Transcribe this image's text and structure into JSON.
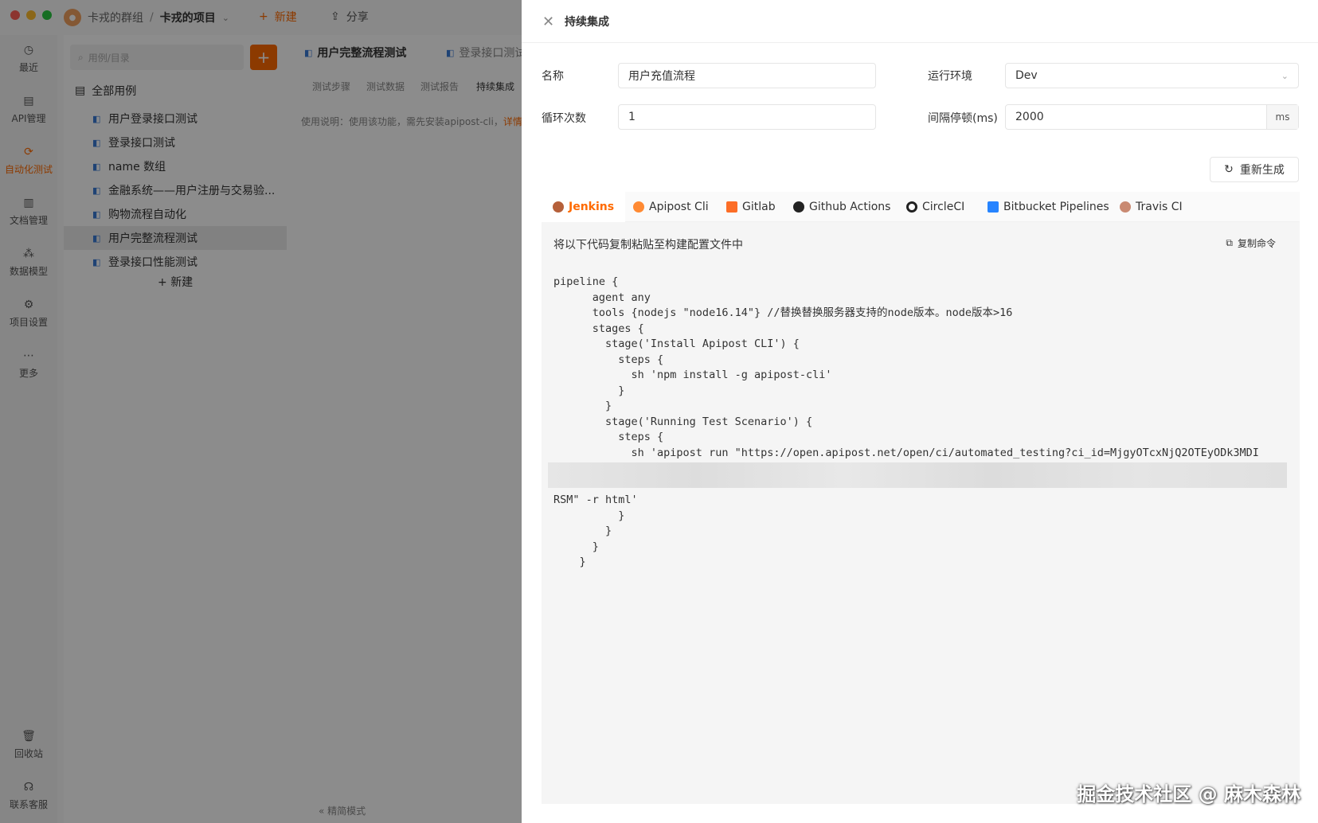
{
  "window": {
    "group": "卡戎的群组",
    "separator": "/",
    "project": "卡戎的项目",
    "new_label": "新建",
    "share_label": "分享"
  },
  "nav": [
    {
      "label": "最近",
      "icon": "clock-icon"
    },
    {
      "label": "API管理",
      "icon": "api-icon"
    },
    {
      "label": "自动化测试",
      "icon": "automation-icon"
    },
    {
      "label": "文档管理",
      "icon": "document-icon"
    },
    {
      "label": "数据模型",
      "icon": "model-icon"
    },
    {
      "label": "项目设置",
      "icon": "settings-icon"
    },
    {
      "label": "更多",
      "icon": "more-icon"
    },
    {
      "label": "回收站",
      "icon": "trash-icon"
    },
    {
      "label": "联系客服",
      "icon": "headset-icon"
    }
  ],
  "tree": {
    "search_placeholder": "用例/目录",
    "root_label": "全部用例",
    "items": [
      "用户登录接口测试",
      "登录接口测试",
      "name 数组",
      "金融系统——用户注册与交易验...",
      "购物流程自动化",
      "用户完整流程测试",
      "登录接口性能测试"
    ],
    "new_label": "新建"
  },
  "main": {
    "tabs": [
      "用户完整流程测试",
      "登录接口测试"
    ],
    "subtabs": [
      "测试步骤",
      "测试数据",
      "测试报告",
      "持续集成"
    ],
    "note": "使用说明：使用该功能，需先安装apipost-cli，",
    "note_link": "详情",
    "simple_mode": "精简模式"
  },
  "drawer": {
    "title": "持续集成",
    "name_label": "名称",
    "name_value": "用户充值流程",
    "env_label": "运行环境",
    "env_value": "Dev",
    "loop_label": "循环次数",
    "loop_value": "1",
    "interval_label": "间隔停顿(ms)",
    "interval_value": "2000",
    "interval_unit": "ms",
    "regen_label": "重新生成",
    "ci_tabs": [
      "Jenkins",
      "Apipost Cli",
      "Gitlab",
      "Github Actions",
      "CircleCI",
      "Bitbucket Pipelines",
      "Travis CI"
    ],
    "hint": "将以下代码复制粘贴至构建配置文件中",
    "copy_label": "复制命令",
    "code_top": "pipeline {\n      agent any\n      tools {nodejs \"node16.14\"} //替换替换服务器支持的node版本。node版本>16\n      stages {\n        stage('Install Apipost CLI') {\n          steps {\n            sh 'npm install -g apipost-cli'\n          }\n        }\n        stage('Running Test Scenario') {\n          steps {\n            sh 'apipost run \"https://open.apipost.net/open/ci/automated_testing?ci_id=MjgyOTcxNjQ2OTEyODk3MDI",
    "code_bottom": "RSM\" -r html'\n          }\n        }\n      }\n    }"
  },
  "watermark": "掘金技术社区 @ 麻木森林",
  "colors": {
    "accent": "#ff6a00"
  }
}
